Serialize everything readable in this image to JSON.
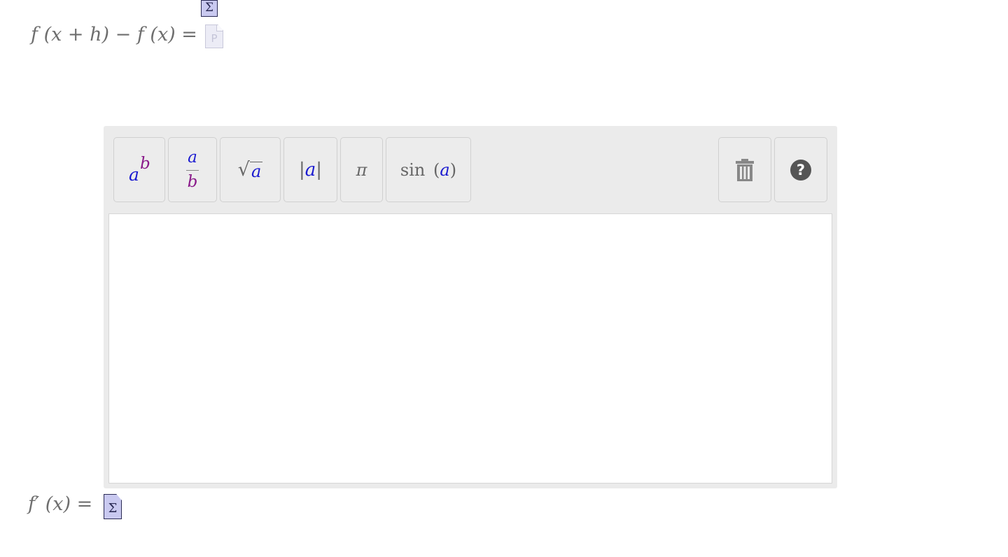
{
  "header": {
    "sum_icon_glyph": "Σ",
    "equation_text": "f (x + h) − f (x) =",
    "placeholder_icon_glyph": "P"
  },
  "toolbar": {
    "power_base": "a",
    "power_exp": "b",
    "frac_num": "a",
    "frac_den": "b",
    "sqrt_symbol": "√",
    "sqrt_arg": "a",
    "abs_bar_left": "|",
    "abs_arg": "a",
    "abs_bar_right": "|",
    "pi_label": "π",
    "sin_label": "sin",
    "sin_open": "(",
    "sin_arg": "a",
    "sin_close": ")",
    "help_label": "?"
  },
  "footer": {
    "equation_text": "f′ (x) =",
    "sum_icon_glyph": "Σ"
  },
  "colors": {
    "var_a": "#1a1ad0",
    "var_b": "#8a1a8a",
    "panel_bg": "#ebebeb"
  }
}
